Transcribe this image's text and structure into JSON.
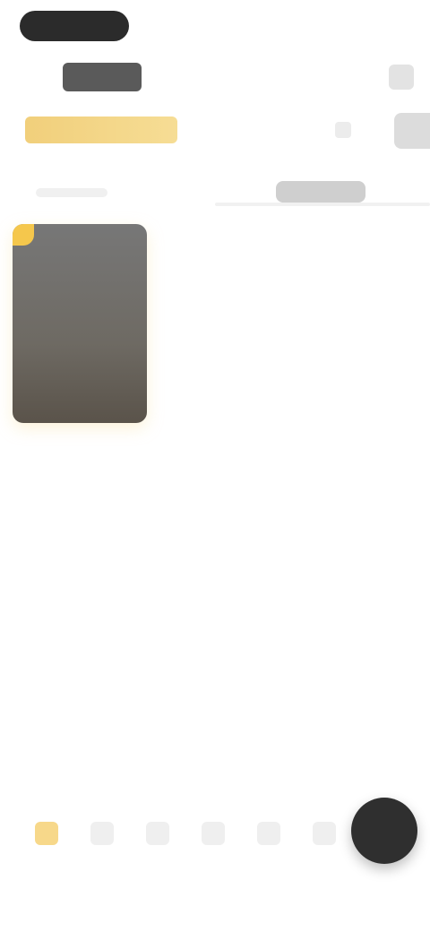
{
  "tabs": [
    {
      "name": "tab-1",
      "active": true
    },
    {
      "name": "tab-2",
      "active": false
    },
    {
      "name": "tab-3",
      "active": false
    },
    {
      "name": "tab-4",
      "active": false
    },
    {
      "name": "tab-5",
      "active": false
    },
    {
      "name": "tab-6",
      "active": false
    }
  ],
  "colors": {
    "accent": "#f5c74c",
    "fab": "#2f2f2f",
    "card": "#6e6a63"
  }
}
